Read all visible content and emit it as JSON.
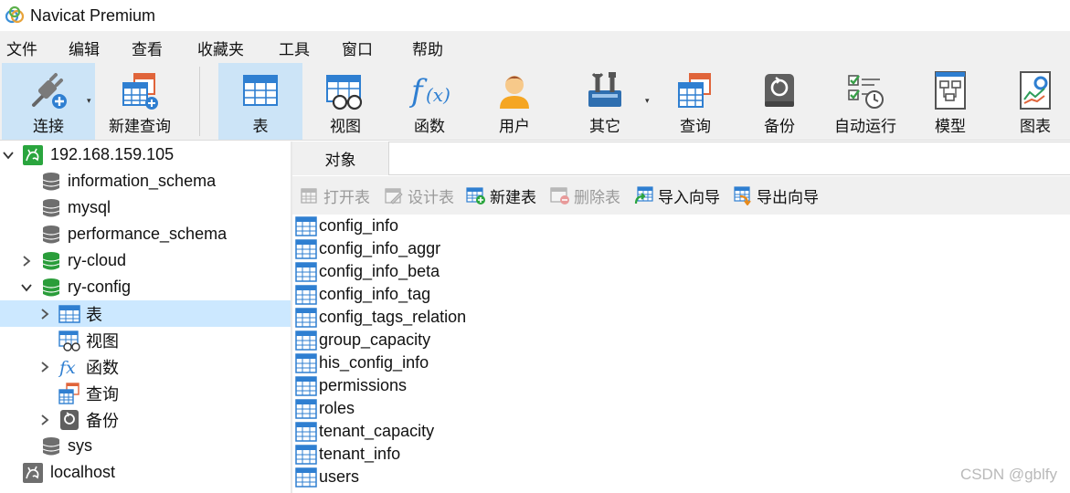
{
  "window": {
    "title": "Navicat Premium"
  },
  "menu": [
    "文件",
    "编辑",
    "查看",
    "收藏夹",
    "工具",
    "窗口",
    "帮助"
  ],
  "toolbar": {
    "connect": "连接",
    "new_query": "新建查询",
    "table": "表",
    "view": "视图",
    "function": "函数",
    "user": "用户",
    "other": "其它",
    "query": "查询",
    "backup": "备份",
    "auto_run": "自动运行",
    "model": "模型",
    "chart": "图表"
  },
  "tree": {
    "connection": "192.168.159.105",
    "databases": {
      "information_schema": "information_schema",
      "mysql": "mysql",
      "performance_schema": "performance_schema",
      "ry_cloud": "ry-cloud",
      "ry_config": "ry-config",
      "sys": "sys"
    },
    "children": {
      "tables": "表",
      "views": "视图",
      "functions": "函数",
      "queries": "查询",
      "backups": "备份"
    },
    "localhost": "localhost"
  },
  "main": {
    "tab": "对象",
    "actions": {
      "open_table": "打开表",
      "design_table": "设计表",
      "new_table": "新建表",
      "delete_table": "删除表",
      "import_wizard": "导入向导",
      "export_wizard": "导出向导"
    },
    "tables": [
      "config_info",
      "config_info_aggr",
      "config_info_beta",
      "config_info_tag",
      "config_tags_relation",
      "group_capacity",
      "his_config_info",
      "permissions",
      "roles",
      "tenant_capacity",
      "tenant_info",
      "users"
    ]
  },
  "watermark": "CSDN @gblfy",
  "colors": {
    "selection": "#cce8ff",
    "toolbar_active": "#cce4f7",
    "chrome": "#f0f0f0",
    "db_green": "#2a9d3a",
    "db_gray": "#6e6e6e",
    "table_blue": "#2f7fd1"
  }
}
